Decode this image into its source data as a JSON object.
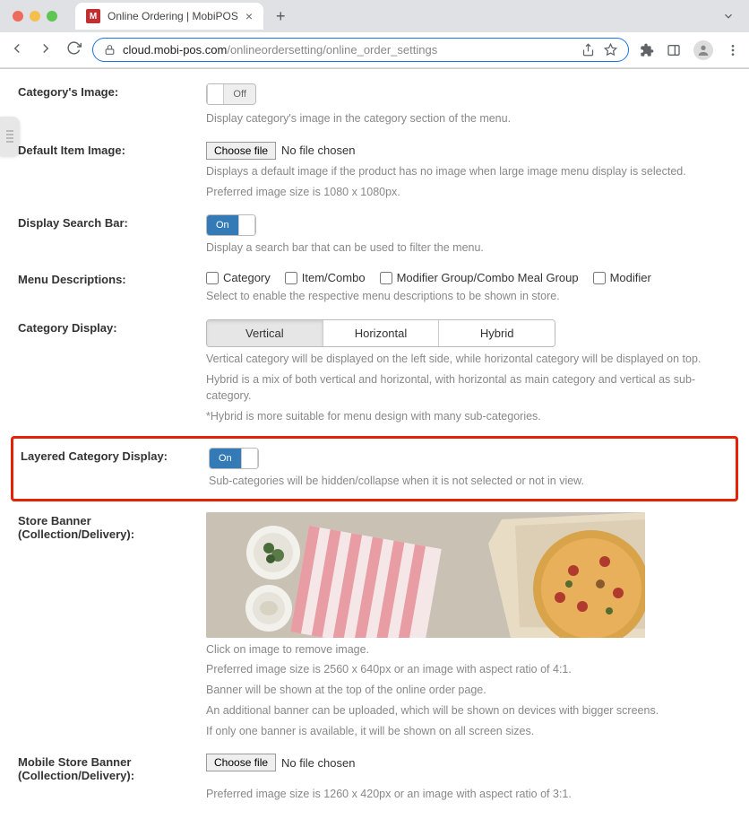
{
  "browser": {
    "tab_title": "Online Ordering | MobiPOS",
    "favicon_letter": "M",
    "url_domain": "cloud.mobi-pos.com",
    "url_path": "/onlineordersetting/online_order_settings"
  },
  "settings": {
    "category_image": {
      "label": "Category's Image:",
      "toggle": "Off",
      "help": "Display category's image in the category section of the menu."
    },
    "default_item_image": {
      "label": "Default Item Image:",
      "button": "Choose file",
      "file_text": "No file chosen",
      "help1": "Displays a default image if the product has no image when large image menu display is selected.",
      "help2": "Preferred image size is 1080 x 1080px."
    },
    "search_bar": {
      "label": "Display Search Bar:",
      "toggle": "On",
      "help": "Display a search bar that can be used to filter the menu."
    },
    "menu_desc": {
      "label": "Menu Descriptions:",
      "options": [
        "Category",
        "Item/Combo",
        "Modifier Group/Combo Meal Group",
        "Modifier"
      ],
      "help": "Select to enable the respective menu descriptions to be shown in store."
    },
    "category_display": {
      "label": "Category Display:",
      "options": [
        "Vertical",
        "Horizontal",
        "Hybrid"
      ],
      "help1": "Vertical category will be displayed on the left side, while horizontal category will be displayed on top.",
      "help2": "Hybrid is a mix of both vertical and horizontal, with horizontal as main category and vertical as sub-category.",
      "help3": "*Hybrid is more suitable for menu design with many sub-categories."
    },
    "layered_category": {
      "label": "Layered Category Display:",
      "toggle": "On",
      "help": "Sub-categories will be hidden/collapse when it is not selected or not in view."
    },
    "store_banner": {
      "label1": "Store Banner",
      "label2": "(Collection/Delivery):",
      "help1": "Click on image to remove image.",
      "help2": "Preferred image size is 2560 x 640px or an image with aspect ratio of 4:1.",
      "help3": "Banner will be shown at the top of the online order page.",
      "help4": "An additional banner can be uploaded, which will be shown on devices with bigger screens.",
      "help5": "If only one banner is available, it will be shown on all screen sizes."
    },
    "mobile_banner": {
      "label1": "Mobile Store Banner",
      "label2": "(Collection/Delivery):",
      "button": "Choose file",
      "file_text": "No file chosen",
      "help": "Preferred image size is 1260 x 420px or an image with aspect ratio of 3:1."
    }
  }
}
